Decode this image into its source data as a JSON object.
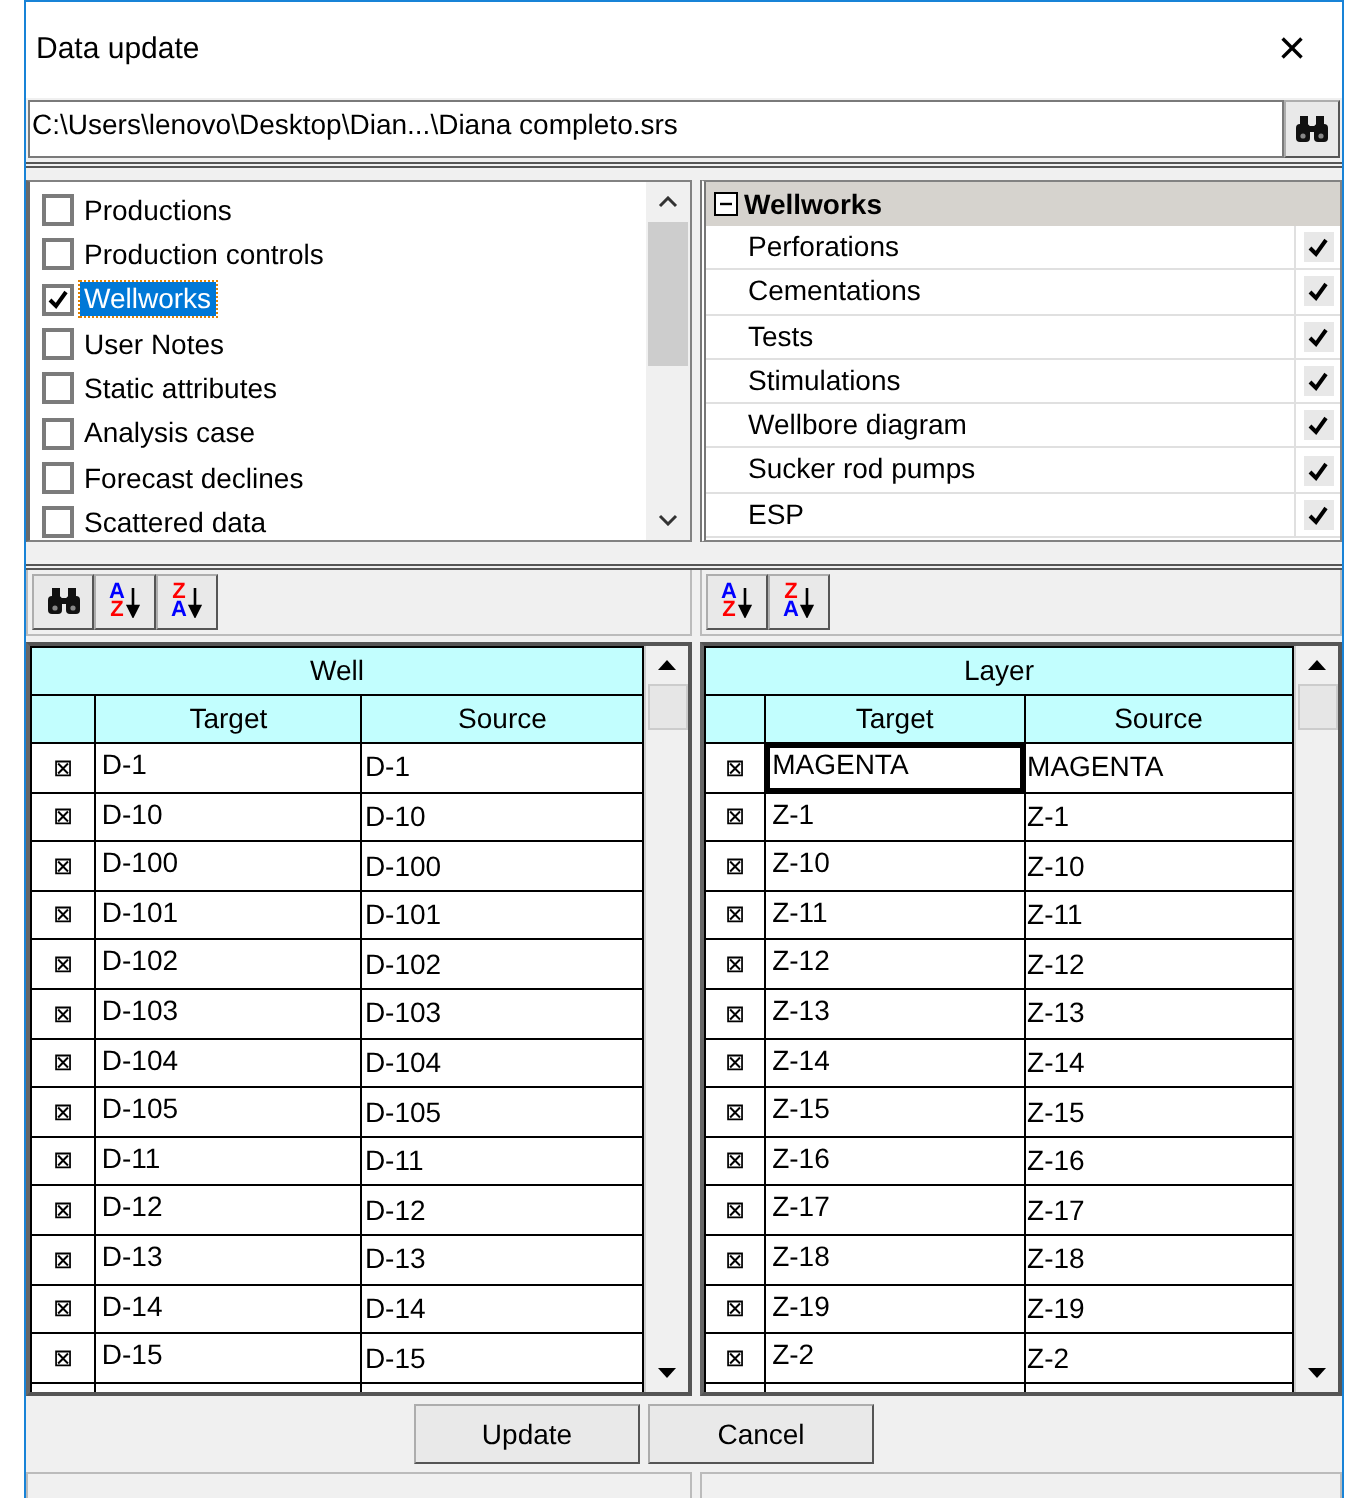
{
  "window": {
    "title": "Data update",
    "close": "×"
  },
  "path": {
    "value": "C:\\Users\\lenovo\\Desktop\\Dian...\\Diana completo.srs"
  },
  "categories": [
    {
      "label": "Productions",
      "checked": false,
      "selected": false
    },
    {
      "label": "Production controls",
      "checked": false,
      "selected": false
    },
    {
      "label": "Wellworks",
      "checked": true,
      "selected": true
    },
    {
      "label": "User Notes",
      "checked": false,
      "selected": false
    },
    {
      "label": "Static attributes",
      "checked": false,
      "selected": false
    },
    {
      "label": "Analysis case",
      "checked": false,
      "selected": false
    },
    {
      "label": "Forecast declines",
      "checked": false,
      "selected": false
    },
    {
      "label": "Scattered data",
      "checked": false,
      "selected": false
    }
  ],
  "properties": {
    "group": "Wellworks",
    "expanded": true,
    "items": [
      {
        "label": "Perforations",
        "checked": true
      },
      {
        "label": "Cementations",
        "checked": true
      },
      {
        "label": "Tests",
        "checked": true
      },
      {
        "label": "Stimulations",
        "checked": true
      },
      {
        "label": "Wellbore diagram",
        "checked": true
      },
      {
        "label": "Sucker rod pumps",
        "checked": true
      },
      {
        "label": "ESP",
        "checked": true
      }
    ]
  },
  "left_toolbar": [
    {
      "kind": "find"
    },
    {
      "kind": "sort",
      "letters": [
        {
          "text": "A",
          "color": "#0000ff"
        },
        {
          "text": "Z",
          "color": "#ff0000"
        }
      ]
    },
    {
      "kind": "sort",
      "letters": [
        {
          "text": "Z",
          "color": "#ff0000"
        },
        {
          "text": "A",
          "color": "#0000ff"
        }
      ]
    }
  ],
  "right_toolbar": [
    {
      "kind": "sort",
      "letters": [
        {
          "text": "A",
          "color": "#0000ff"
        },
        {
          "text": "Z",
          "color": "#ff0000"
        }
      ]
    },
    {
      "kind": "sort",
      "letters": [
        {
          "text": "Z",
          "color": "#ff0000"
        },
        {
          "text": "A",
          "color": "#0000ff"
        }
      ]
    }
  ],
  "well_grid": {
    "group_header": "Well",
    "columns": [
      "Target",
      "Source"
    ],
    "rows": [
      {
        "mark": "⊠",
        "target": "D-1",
        "source": "D-1",
        "selected": false
      },
      {
        "mark": "⊠",
        "target": "D-10",
        "source": "D-10",
        "selected": false
      },
      {
        "mark": "⊠",
        "target": "D-100",
        "source": "D-100",
        "selected": false
      },
      {
        "mark": "⊠",
        "target": "D-101",
        "source": "D-101",
        "selected": false
      },
      {
        "mark": "⊠",
        "target": "D-102",
        "source": "D-102",
        "selected": false
      },
      {
        "mark": "⊠",
        "target": "D-103",
        "source": "D-103",
        "selected": false
      },
      {
        "mark": "⊠",
        "target": "D-104",
        "source": "D-104",
        "selected": false
      },
      {
        "mark": "⊠",
        "target": "D-105",
        "source": "D-105",
        "selected": false
      },
      {
        "mark": "⊠",
        "target": "D-11",
        "source": "D-11",
        "selected": false
      },
      {
        "mark": "⊠",
        "target": "D-12",
        "source": "D-12",
        "selected": false
      },
      {
        "mark": "⊠",
        "target": "D-13",
        "source": "D-13",
        "selected": false
      },
      {
        "mark": "⊠",
        "target": "D-14",
        "source": "D-14",
        "selected": false
      },
      {
        "mark": "⊠",
        "target": "D-15",
        "source": "D-15",
        "selected": false
      }
    ]
  },
  "layer_grid": {
    "group_header": "Layer",
    "columns": [
      "Target",
      "Source"
    ],
    "rows": [
      {
        "mark": "⊠",
        "target": "MAGENTA",
        "source": "MAGENTA",
        "selected": true
      },
      {
        "mark": "⊠",
        "target": "Z-1",
        "source": "Z-1",
        "selected": false
      },
      {
        "mark": "⊠",
        "target": "Z-10",
        "source": "Z-10",
        "selected": false
      },
      {
        "mark": "⊠",
        "target": "Z-11",
        "source": "Z-11",
        "selected": false
      },
      {
        "mark": "⊠",
        "target": "Z-12",
        "source": "Z-12",
        "selected": false
      },
      {
        "mark": "⊠",
        "target": "Z-13",
        "source": "Z-13",
        "selected": false
      },
      {
        "mark": "⊠",
        "target": "Z-14",
        "source": "Z-14",
        "selected": false
      },
      {
        "mark": "⊠",
        "target": "Z-15",
        "source": "Z-15",
        "selected": false
      },
      {
        "mark": "⊠",
        "target": "Z-16",
        "source": "Z-16",
        "selected": false
      },
      {
        "mark": "⊠",
        "target": "Z-17",
        "source": "Z-17",
        "selected": false
      },
      {
        "mark": "⊠",
        "target": "Z-18",
        "source": "Z-18",
        "selected": false
      },
      {
        "mark": "⊠",
        "target": "Z-19",
        "source": "Z-19",
        "selected": false
      },
      {
        "mark": "⊠",
        "target": "Z-2",
        "source": "Z-2",
        "selected": false
      }
    ]
  },
  "buttons": [
    {
      "label": "Update"
    },
    {
      "label": "Cancel"
    }
  ]
}
